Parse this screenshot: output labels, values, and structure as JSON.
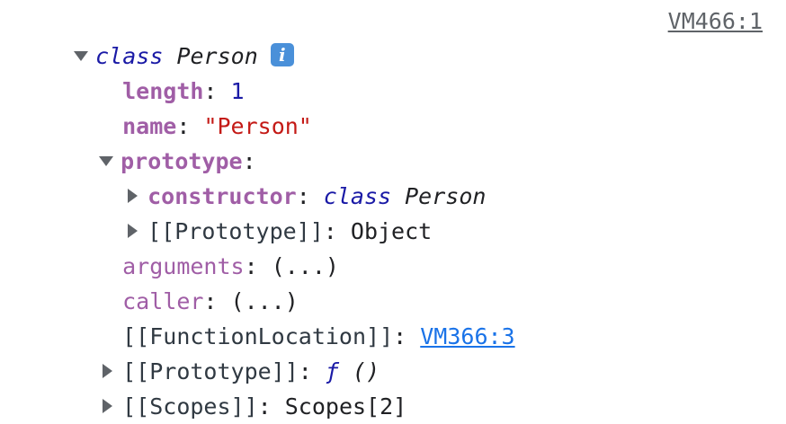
{
  "header": {
    "keyword": "class",
    "name": "Person",
    "info_glyph": "i",
    "source_link": "VM466:1"
  },
  "props": {
    "length_key": "length",
    "length_val": "1",
    "name_key": "name",
    "name_val": "\"Person\"",
    "prototype_key": "prototype",
    "constructor_key": "constructor",
    "constructor_kw": "class",
    "constructor_name": "Person",
    "proto_inner_key": "[[Prototype]]",
    "proto_inner_val": "Object",
    "arguments_key": "arguments",
    "arguments_val": "(...)",
    "caller_key": "caller",
    "caller_val": "(...)",
    "funcloc_key": "[[FunctionLocation]]",
    "funcloc_val": "VM366:3",
    "proto_key": "[[Prototype]]",
    "proto_val_f": "ƒ",
    "proto_val_parens": "()",
    "scopes_key": "[[Scopes]]",
    "scopes_val": "Scopes[2]"
  },
  "colors": {
    "key": "#a05ea6",
    "number": "#1a1aa6",
    "string": "#c41a16",
    "link": "#1a73e8",
    "info_badge": "#4a90d9"
  }
}
